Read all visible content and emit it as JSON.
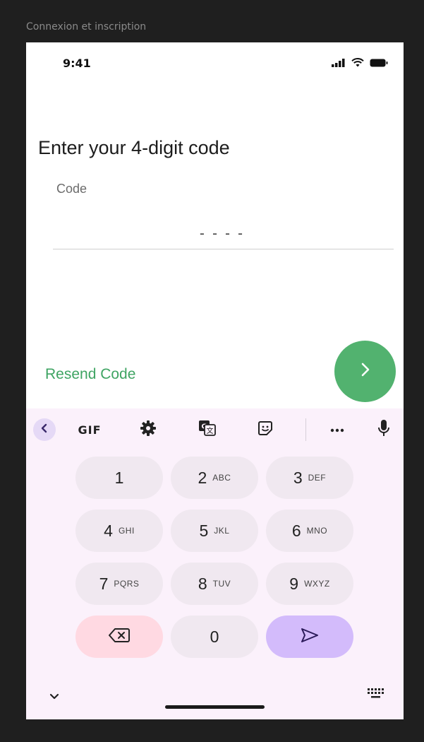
{
  "frame": {
    "label": "Connexion et inscription"
  },
  "status_bar": {
    "time": "9:41"
  },
  "screen": {
    "title": "Enter your 4-digit code",
    "code_label": "Code",
    "code_placeholder": "----",
    "resend_label": "Resend Code"
  },
  "keyboard": {
    "gif_label": "GIF",
    "keys": [
      {
        "num": "1",
        "letters": ""
      },
      {
        "num": "2",
        "letters": "ABC"
      },
      {
        "num": "3",
        "letters": "DEF"
      },
      {
        "num": "4",
        "letters": "GHI"
      },
      {
        "num": "5",
        "letters": "JKL"
      },
      {
        "num": "6",
        "letters": "MNO"
      },
      {
        "num": "7",
        "letters": "PQRS"
      },
      {
        "num": "8",
        "letters": "TUV"
      },
      {
        "num": "9",
        "letters": "WXYZ"
      },
      {
        "num": "0",
        "letters": ""
      }
    ]
  },
  "colors": {
    "accent_green": "#52b26f",
    "keyboard_bg": "#fbf1fb",
    "send_key": "#d3bbfb",
    "delete_key": "#ffd9e2"
  },
  "icons": [
    "signal-icon",
    "wifi-icon",
    "battery-icon",
    "chevron-right-icon",
    "chevron-left-icon",
    "gear-icon",
    "translate-icon",
    "sticker-icon",
    "more-icon",
    "mic-icon",
    "backspace-icon",
    "send-icon",
    "chevron-down-icon",
    "keyboard-icon"
  ]
}
